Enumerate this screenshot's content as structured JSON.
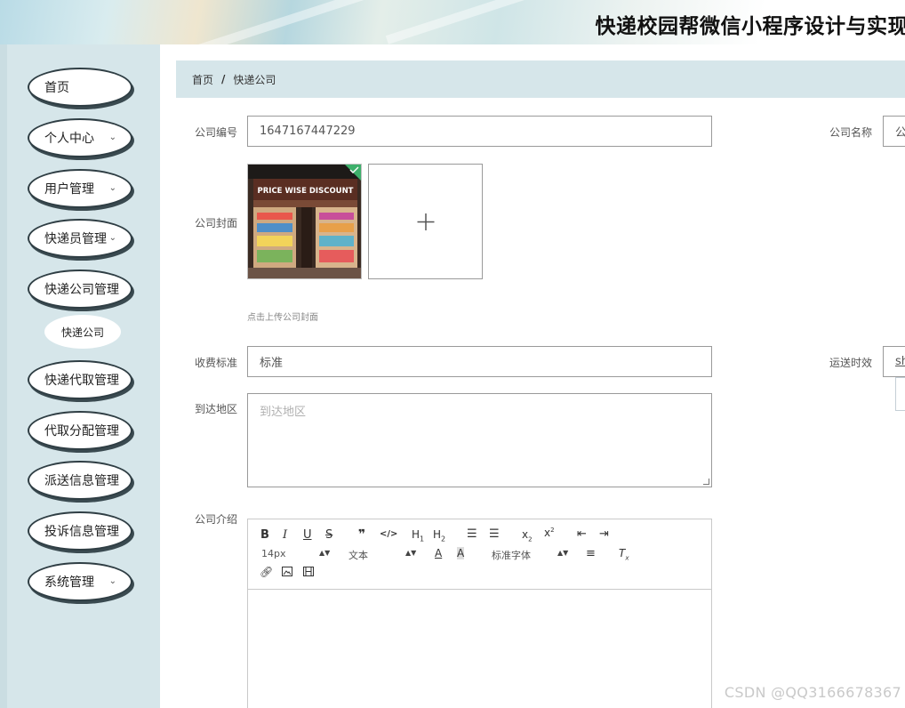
{
  "header": {
    "title": "快递校园帮微信小程序设计与实现"
  },
  "sidebar": {
    "items": [
      {
        "label": "首页",
        "chevron": ""
      },
      {
        "label": "个人中心",
        "chevron": "⌄"
      },
      {
        "label": "用户管理",
        "chevron": "⌄"
      },
      {
        "label": "快递员管理",
        "chevron": "⌄"
      },
      {
        "label": "快递公司管理",
        "chevron": ""
      },
      {
        "label": "快递代取管理",
        "chevron": ""
      },
      {
        "label": "代取分配管理",
        "chevron": ""
      },
      {
        "label": "派送信息管理",
        "chevron": ""
      },
      {
        "label": "投诉信息管理",
        "chevron": ""
      },
      {
        "label": "系统管理",
        "chevron": "⌄"
      }
    ],
    "sub_item": "快递公司"
  },
  "breadcrumb": {
    "home": "首页",
    "separator": "/",
    "current": "快递公司"
  },
  "form": {
    "company_no_label": "公司编号",
    "company_no_value": "1647167447229",
    "company_name_label": "公司名称",
    "company_name_value": "公",
    "cover_label": "公司封面",
    "cover_image_sign": "PRICE WISE DISCOUNT",
    "cover_hint": "点击上传公司封面",
    "fee_label": "收费标准",
    "fee_value": "标准",
    "delivery_time_label": "运送时效",
    "delivery_time_value": "sh",
    "area_label": "到达地区",
    "area_placeholder": "到达地区",
    "intro_label": "公司介绍"
  },
  "editor": {
    "font_size": "14px",
    "text_style": "文本",
    "font_family": "标准字体"
  },
  "watermark": "CSDN @QQ3166678367",
  "colors": {
    "sidebar_bg": "#d6e6ea",
    "breadcrumb_bg": "#d6e6ea",
    "nav_border": "#2f3e44",
    "success": "#3db06b"
  }
}
